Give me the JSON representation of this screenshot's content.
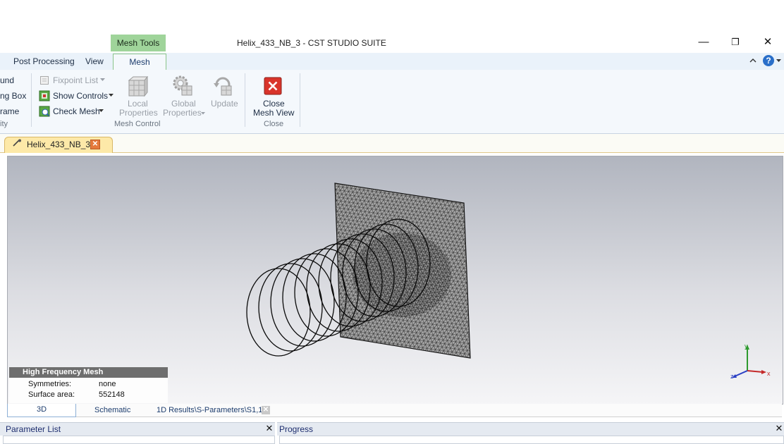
{
  "window": {
    "title": "Helix_433_NB_3 - CST STUDIO SUITE",
    "context_tab": "Mesh Tools",
    "controls": {
      "minimize": "—",
      "restore": "❐",
      "close": "✕"
    }
  },
  "ribbon_tabs": [
    "Post Processing",
    "View",
    "Mesh"
  ],
  "help_glyph": "?",
  "ribbon": {
    "left_clipped": [
      "und",
      "ng Box",
      "rame",
      "ity"
    ],
    "mesh_tools_col": {
      "fixpoint": "Fixpoint List",
      "show_controls": "Show Controls",
      "check_mesh": "Check Mesh"
    },
    "local_props": [
      "Local",
      "Properties"
    ],
    "global_props": [
      "Global",
      "Properties"
    ],
    "update": "Update",
    "mesh_control_group": "Mesh Control",
    "close_mesh": [
      "Close",
      "Mesh View"
    ],
    "close_group": "Close"
  },
  "doc_tab": {
    "label": "Helix_433_NB_3*"
  },
  "mesh_info": {
    "title": "High Frequency Mesh",
    "rows": [
      {
        "key": "Symmetries:",
        "value": "none"
      },
      {
        "key": "Surface area:",
        "value": "552148"
      }
    ]
  },
  "axes": {
    "x": "x",
    "y": "y",
    "z": "z"
  },
  "view_tabs": [
    "3D",
    "Schematic",
    "1D Results\\S-Parameters\\S1,1"
  ],
  "panels": {
    "parameter_list": "Parameter List",
    "progress": "Progress"
  },
  "colors": {
    "accent_green": "#9fd49a",
    "doc_tab": "#fde9a8",
    "close_red": "#d9342b",
    "mesh_plate": "#a6a6a6"
  }
}
